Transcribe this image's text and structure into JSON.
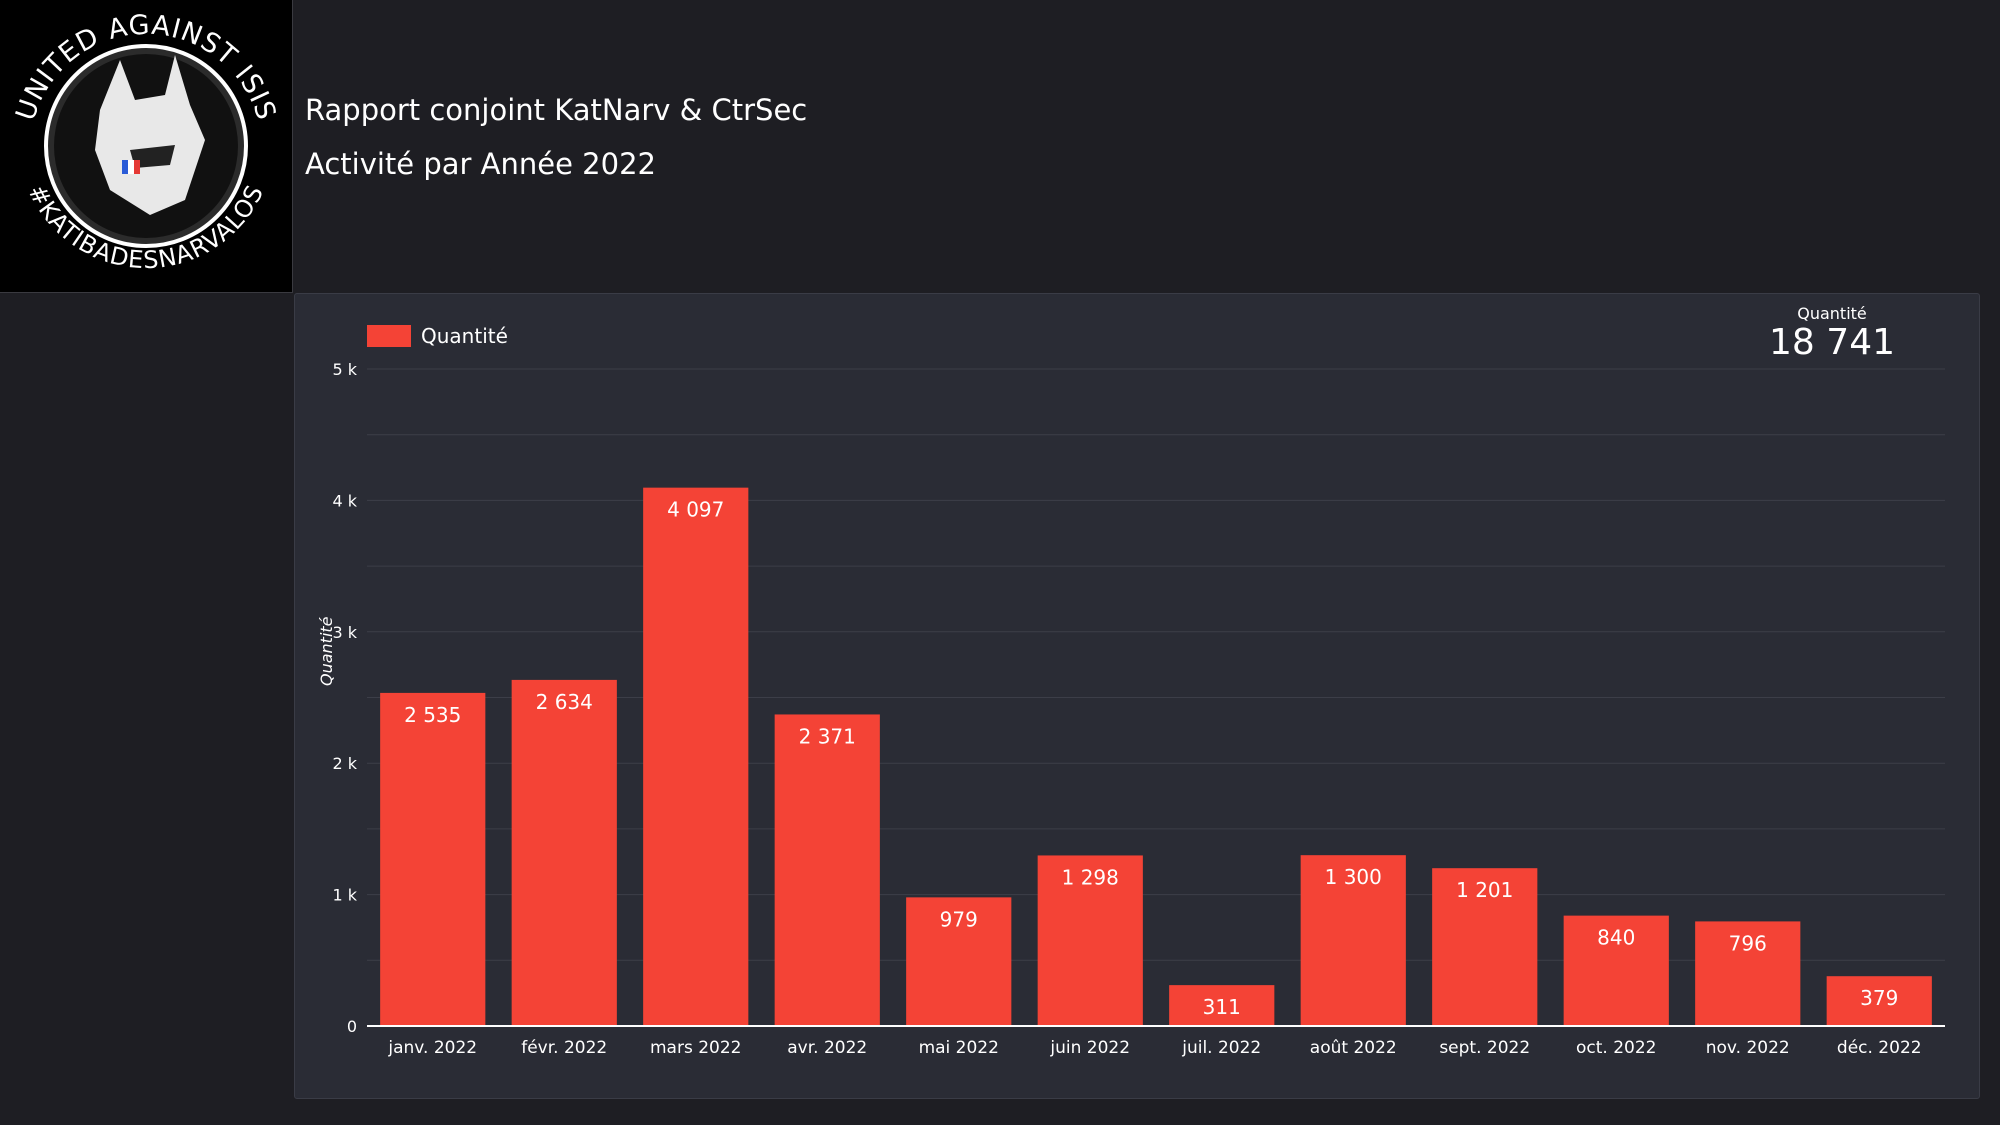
{
  "logo": {
    "text_top": "UNITED AGAINST ISIS",
    "text_bottom": "#KATIBADESNARVALOS"
  },
  "header": {
    "title": "Rapport conjoint KatNarv & CtrSec",
    "subtitle": "Activité par Année 2022"
  },
  "kpi": {
    "label": "Quantité",
    "value": "18 741"
  },
  "legend": {
    "label": "Quantité"
  },
  "colors": {
    "bar": "#f44336",
    "background": "#1e1e23",
    "panel": "#2a2c35"
  },
  "chart_data": {
    "type": "bar",
    "title": "",
    "xlabel": "",
    "ylabel": "Quantité",
    "ylim": [
      0,
      5000
    ],
    "yticks": [
      0,
      1000,
      2000,
      3000,
      4000,
      5000
    ],
    "ytick_labels": [
      "0",
      "1 k",
      "2 k",
      "3 k",
      "4 k",
      "5 k"
    ],
    "grid": true,
    "legend_position": "top-left",
    "categories": [
      "janv. 2022",
      "févr. 2022",
      "mars 2022",
      "avr. 2022",
      "mai 2022",
      "juin 2022",
      "juil. 2022",
      "août 2022",
      "sept. 2022",
      "oct. 2022",
      "nov. 2022",
      "déc. 2022"
    ],
    "series": [
      {
        "name": "Quantité",
        "values": [
          2535,
          2634,
          4097,
          2371,
          979,
          1298,
          311,
          1300,
          1201,
          840,
          796,
          379
        ],
        "value_labels": [
          "2 535",
          "2 634",
          "4 097",
          "2 371",
          "979",
          "1 298",
          "311",
          "1 300",
          "1 201",
          "840",
          "796",
          "379"
        ]
      }
    ]
  }
}
